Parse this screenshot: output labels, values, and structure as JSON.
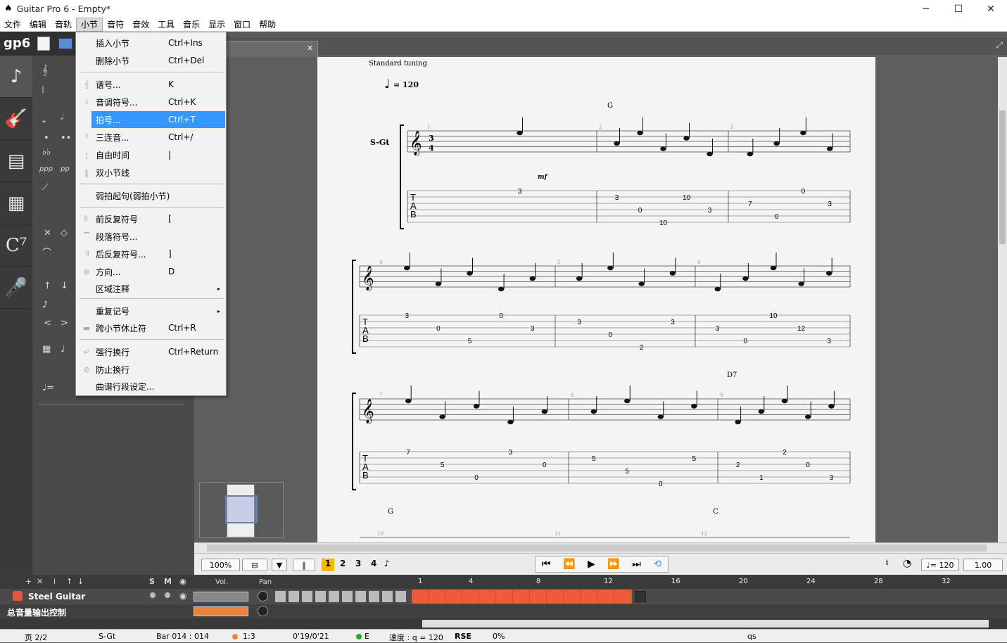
{
  "app": {
    "title": "Guitar Pro 6 - Empty*",
    "min": "─",
    "max": "☐",
    "close": "✕"
  },
  "menu": [
    "文件",
    "编辑",
    "音轨",
    "小节",
    "音符",
    "音效",
    "工具",
    "音乐",
    "显示",
    "窗口",
    "帮助"
  ],
  "dropdown": [
    {
      "label": "插入小节",
      "shortcut": "Ctrl+Ins",
      "icon": ""
    },
    {
      "label": "删除小节",
      "shortcut": "Ctrl+Del",
      "icon": ""
    },
    {
      "label": "谱号...",
      "shortcut": "K",
      "icon": "𝄞"
    },
    {
      "label": "音调符号...",
      "shortcut": "Ctrl+K",
      "icon": "♯"
    },
    {
      "label": "拍号...",
      "shortcut": "Ctrl+T",
      "icon": "‖"
    },
    {
      "label": "三连音...",
      "shortcut": "Ctrl+/",
      "icon": "³"
    },
    {
      "label": "自由时间",
      "shortcut": "|",
      "icon": "¦"
    },
    {
      "label": "双小节线",
      "shortcut": "",
      "icon": "‖"
    },
    {
      "label": "弱拍起句(弱拍小节)",
      "shortcut": "",
      "icon": ""
    },
    {
      "label": "前反复符号",
      "shortcut": "[",
      "icon": "𝄆"
    },
    {
      "label": "段落符号...",
      "shortcut": "",
      "icon": "▔"
    },
    {
      "label": "后反复符号...",
      "shortcut": "]",
      "icon": "𝄇"
    },
    {
      "label": "方向...",
      "shortcut": "D",
      "icon": "⊕"
    },
    {
      "label": "区域注释",
      "shortcut": "",
      "icon": "",
      "submenu": "▸"
    },
    {
      "label": "重复记号",
      "shortcut": "",
      "icon": "",
      "submenu": "▸"
    },
    {
      "label": "跨小节休止符",
      "shortcut": "Ctrl+R",
      "icon": "▬"
    },
    {
      "label": "强行换行",
      "shortcut": "Ctrl+Return",
      "icon": "↵"
    },
    {
      "label": "防止换行",
      "shortcut": "",
      "icon": "⊘"
    },
    {
      "label": "曲谱行段设定...",
      "shortcut": "",
      "icon": ""
    }
  ],
  "score": {
    "tuning": "Standard tuning",
    "tempo": "= 120",
    "track_short": "S-Gt",
    "dynamic": "mf",
    "chords": [
      "G",
      "D7",
      "G",
      "C"
    ],
    "bar_numbers": [
      "1",
      "2",
      "3",
      "4",
      "5",
      "6",
      "7",
      "8",
      "9",
      "10",
      "11",
      "12"
    ],
    "tab_letters": [
      "T",
      "A",
      "B"
    ],
    "sys1_tab": [
      [
        "3"
      ],
      [
        "3",
        "0",
        "10",
        "10",
        "3"
      ],
      [
        "7",
        "0",
        "0",
        "3"
      ]
    ],
    "sys2_tab": [
      [
        "3",
        "0",
        "5",
        "0",
        "3"
      ],
      [
        "3",
        "0",
        "2",
        "3"
      ],
      [
        "3",
        "0",
        "10",
        "12",
        "3"
      ]
    ],
    "sys3_tab": [
      [
        "7",
        "5",
        "0",
        "3",
        "0"
      ],
      [
        "5",
        "5",
        "0",
        "5"
      ],
      [
        "2",
        "1",
        "2",
        "0",
        "3"
      ]
    ]
  },
  "gp_logo": "gp6",
  "toolbar": {
    "zoom": "100%",
    "bar_nums": [
      "1",
      "2",
      "3",
      "4"
    ],
    "tempo": "♩= 120",
    "speed": "1.00"
  },
  "tracks": {
    "cols": [
      "S",
      "M",
      "Vol.",
      "Pan"
    ],
    "track_name": "Steel Guitar",
    "master": "总音量输出控制",
    "ruler": [
      "1",
      "4",
      "8",
      "12",
      "16",
      "20",
      "24",
      "28",
      "32"
    ]
  },
  "status": {
    "page": "页 2/2",
    "track": "S-Gt",
    "bar": "Bar 014 : 014",
    "time_sig": "1:3",
    "time": "0'19/0'21",
    "key": "E",
    "tempo": "速度 : q = 120",
    "rse": "RSE",
    "pct": "0%",
    "note": "qs"
  }
}
